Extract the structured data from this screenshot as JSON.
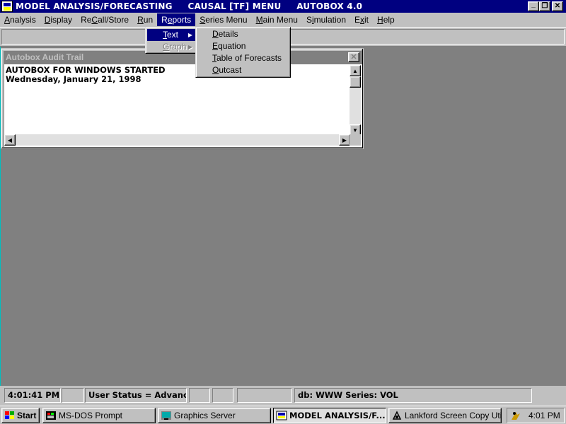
{
  "window": {
    "title": "MODEL ANALYSIS/FORECASTING     CAUSAL [TF] MENU     AUTOBOX 4.0",
    "minimize_glyph": "_",
    "maximize_glyph": "❐",
    "close_glyph": "✕"
  },
  "menubar": {
    "items": [
      {
        "pre": "",
        "u": "A",
        "post": "nalysis"
      },
      {
        "pre": "",
        "u": "D",
        "post": "isplay"
      },
      {
        "pre": "Re",
        "u": "C",
        "post": "all/Store"
      },
      {
        "pre": "",
        "u": "R",
        "post": "un"
      },
      {
        "pre": "R",
        "u": "e",
        "post": "ports"
      },
      {
        "pre": "",
        "u": "S",
        "post": "eries Menu"
      },
      {
        "pre": "",
        "u": "M",
        "post": "ain Menu"
      },
      {
        "pre": "S",
        "u": "i",
        "post": "mulation"
      },
      {
        "pre": "E",
        "u": "x",
        "post": "it"
      },
      {
        "pre": "",
        "u": "H",
        "post": "elp"
      }
    ],
    "active_index": 4
  },
  "reports_menu": {
    "items": [
      {
        "u": "T",
        "post": "ext",
        "state": "selected"
      },
      {
        "u": "G",
        "post": "raph",
        "state": "disabled"
      }
    ]
  },
  "text_submenu": {
    "items": [
      {
        "u": "D",
        "post": "etails"
      },
      {
        "u": "E",
        "post": "quation"
      },
      {
        "u": "T",
        "post": "able of Forecasts"
      },
      {
        "u": "O",
        "post": "utcast"
      }
    ]
  },
  "audit_trail": {
    "title": "Autobox Audit Trail",
    "lines": [
      "AUTOBOX FOR WINDOWS STARTED",
      "Wednesday, January 21, 1998"
    ]
  },
  "statusbar": {
    "time": "4:01:41 PM",
    "user_status": "User Status = Advanced",
    "db_series": "db: WWW Series: VOL"
  },
  "taskbar": {
    "start": "Start",
    "tasks": [
      {
        "label": "MS-DOS Prompt",
        "icon": "ms-dos-icon"
      },
      {
        "label": "Graphics Server",
        "icon": "graphics-server-icon"
      },
      {
        "label": "MODEL ANALYSIS/F...",
        "icon": "autobox-icon",
        "active": true
      },
      {
        "label": "Lankford Screen Copy Utility",
        "icon": "screen-copy-icon"
      }
    ],
    "clock": "4:01 PM"
  }
}
